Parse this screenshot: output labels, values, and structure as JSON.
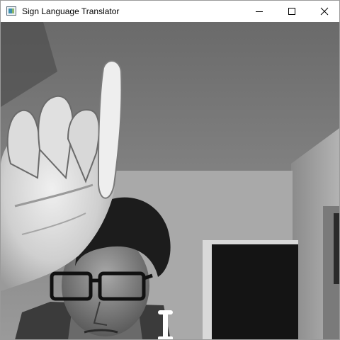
{
  "window": {
    "title": "Sign Language Translator",
    "controls": {
      "minimize_icon": "minimize-icon",
      "maximize_icon": "maximize-icon",
      "close_icon": "close-icon"
    }
  },
  "video_feed": {
    "mode": "grayscale"
  },
  "colors": {
    "titlebar_bg": "#ffffff",
    "title_text": "#000000",
    "close_hover": "#e81123"
  }
}
